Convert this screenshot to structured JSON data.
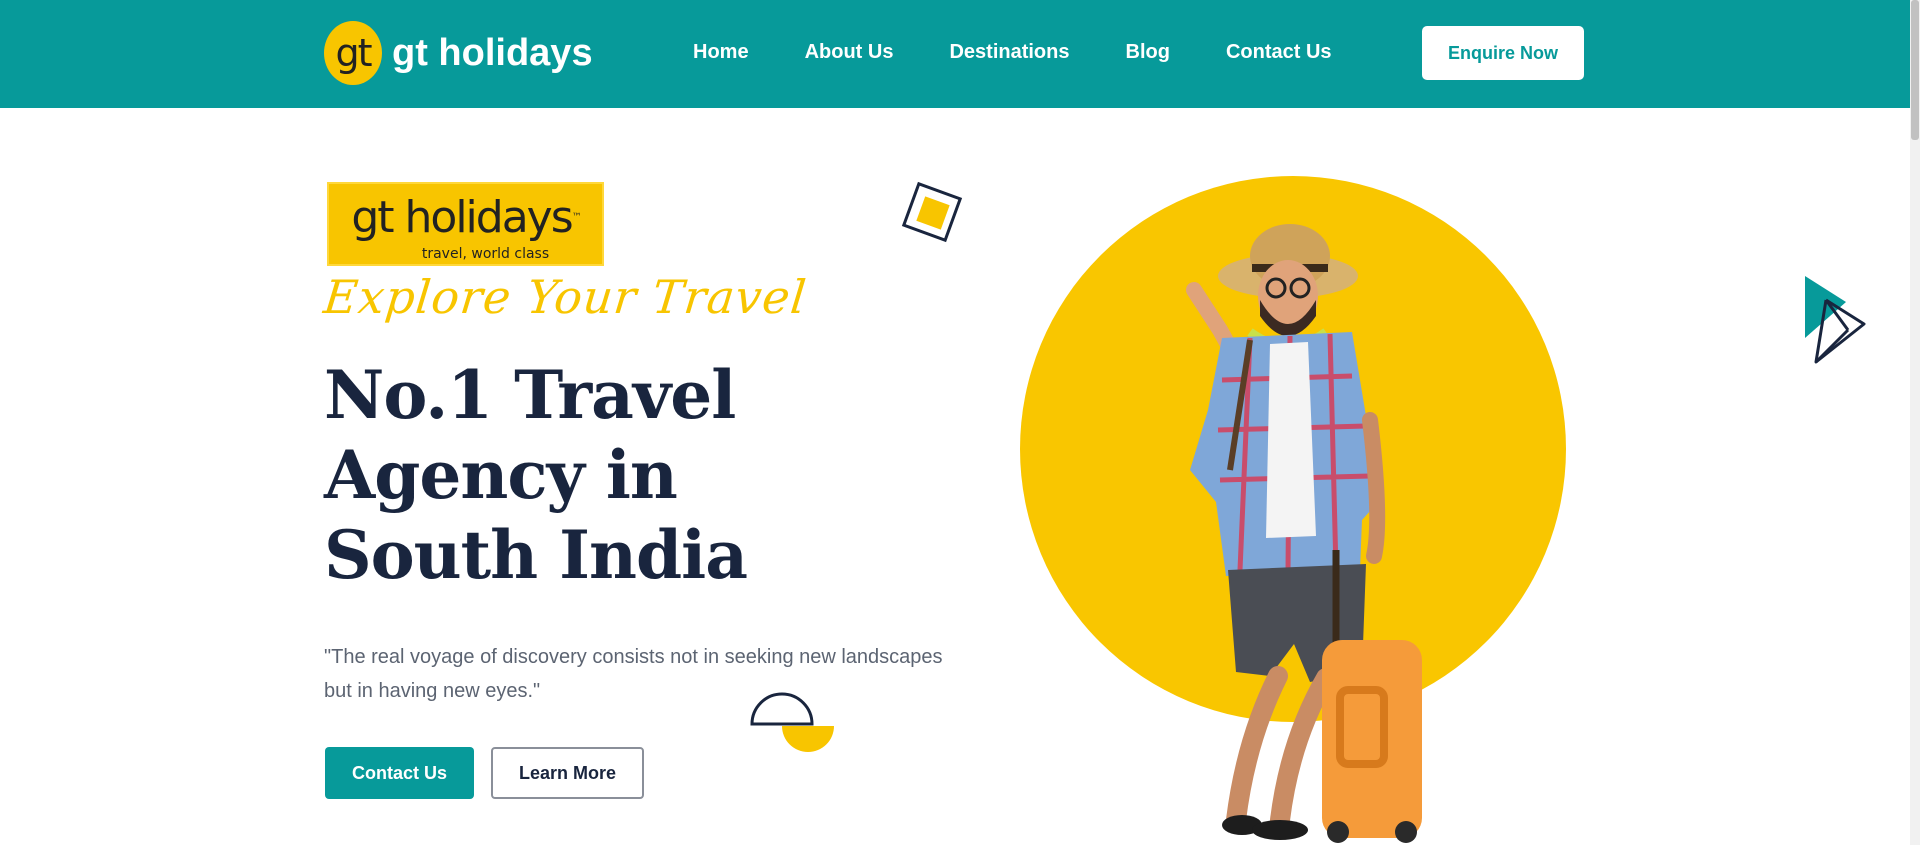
{
  "header": {
    "brand_badge": "gt",
    "brand_name": "gt holidays",
    "nav": [
      "Home",
      "About Us",
      "Destinations",
      "Blog",
      "Contact Us"
    ],
    "cta_label": "Enquire Now"
  },
  "hero": {
    "logo_main": "gt holidays",
    "logo_tag": "travel, world class",
    "tagline": "Explore Your Travel",
    "headline_lines": [
      "No.1 Travel",
      "Agency in",
      "South India"
    ],
    "quote": "\"The real voyage of discovery consists not in seeking new landscapes but in having new eyes.\"",
    "primary_button": "Contact Us",
    "secondary_button": "Learn More"
  },
  "colors": {
    "teal": "#079a9a",
    "yellow": "#f8c500",
    "navy": "#19253e",
    "white": "#ffffff"
  },
  "icons": [
    "diamond-square-icon",
    "half-circle-icon",
    "paper-plane-icon"
  ]
}
